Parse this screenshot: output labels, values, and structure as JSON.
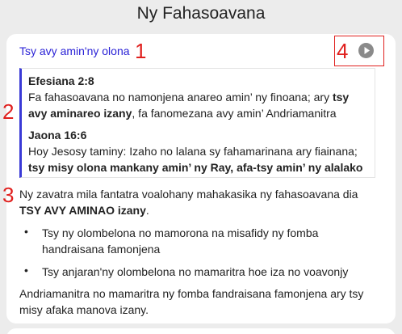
{
  "header": {
    "title": "Ny Fahasoavana"
  },
  "card": {
    "section_link": "Tsy avy amin'ny olona",
    "markers": {
      "m1": "1",
      "m2": "2",
      "m3": "3",
      "m4": "4"
    },
    "verses": [
      {
        "reference": "Efesiana 2:8",
        "text_plain_1": "Fa fahasoavana no namonjena anareo amin’ ny finoana; ary ",
        "text_bold": "tsy avy aminareo izany",
        "text_plain_2": ", fa fanomezana avy amin’ Andriamanitra"
      },
      {
        "reference": "Jaona 16:6",
        "text_plain_1": "Hoy Jesosy taminy: Izaho no lalana sy fahamarinana ary fiainana; ",
        "text_bold": "tsy misy olona mankany amin’ ny Ray, afa-tsy amin’ ny alalako",
        "text_plain_2": ""
      }
    ],
    "intro_plain": "Ny zavatra mila fantatra voalohany mahakasika ny fahasoavana dia ",
    "intro_bold": "TSY AVY AMINAO izany",
    "intro_end": ".",
    "bullet_char": "•",
    "bullets": [
      "Tsy ny olombelona no mamorona na misafidy ny fomba handraisana famonjena",
      "Tsy anjaran'ny olombelona no mamaritra hoe iza no voavonjy"
    ],
    "closing": "Andriamanitra no mamaritra ny fomba fandraisana famonjena ary tsy misy afaka manova izany."
  },
  "colors": {
    "link": "#2a22d6",
    "marker": "#e0201e",
    "verse_border": "#3a3ad6",
    "play": "#8a8a8a"
  },
  "icons": {
    "play": "play-circle-icon"
  }
}
